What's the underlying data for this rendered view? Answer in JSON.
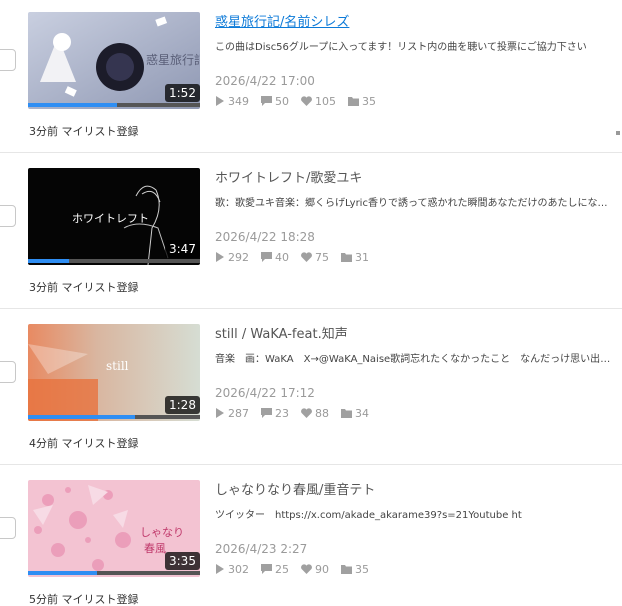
{
  "items": [
    {
      "title": "惑星旅行記/名前シレズ",
      "title_link": true,
      "description": "この曲はDisc56グループに入ってます！リスト内の曲を聴いて投票にご協力下さい",
      "date": "2026/4/22 17:00",
      "views": "349",
      "comments": "50",
      "likes": "105",
      "mylists": "35",
      "duration": "1:52",
      "progress": 0.52,
      "added": "3分前 マイリスト登録",
      "thumb_text": "惑星旅行記"
    },
    {
      "title": "ホワイトレフト/歌愛ユキ",
      "title_link": false,
      "description": "歌：歌愛ユキ音楽：郷くらげLyric香りで誘って惑かれた瞬間あなただけのあたしになりたくて",
      "date": "2026/4/22 18:28",
      "views": "292",
      "comments": "40",
      "likes": "75",
      "mylists": "31",
      "duration": "3:47",
      "progress": 0.24,
      "added": "3分前 マイリスト登録",
      "thumb_text": "ホワイトレフト"
    },
    {
      "title": "still / WaKA-feat.知声",
      "title_link": false,
      "description": "音楽　画：WaKA　X→@WaKA_Naise歌詞忘れたくなかったこと　なんだっけ思い出せない",
      "date": "2026/4/22 17:12",
      "views": "287",
      "comments": "23",
      "likes": "88",
      "mylists": "34",
      "duration": "1:28",
      "progress": 0.62,
      "added": "4分前 マイリスト登録",
      "thumb_text": "still"
    },
    {
      "title": "しゃなりなり春風/重音テト",
      "title_link": false,
      "description": "ツイッター　https://x.com/akade_akarame39?s=21Youtube ht",
      "date": "2026/4/23 2:27",
      "views": "302",
      "comments": "25",
      "likes": "90",
      "mylists": "35",
      "duration": "3:35",
      "progress": 0.4,
      "added": "5分前 マイリスト登録",
      "thumb_text_1": "しゃなり",
      "thumb_text_2": "春風"
    }
  ],
  "colors": {
    "link": "#0c7ad8",
    "progress": "#2f8ef3",
    "meta": "#9a9a9a"
  },
  "icons": [
    "play-icon",
    "comment-icon",
    "heart-icon",
    "folder-icon"
  ]
}
